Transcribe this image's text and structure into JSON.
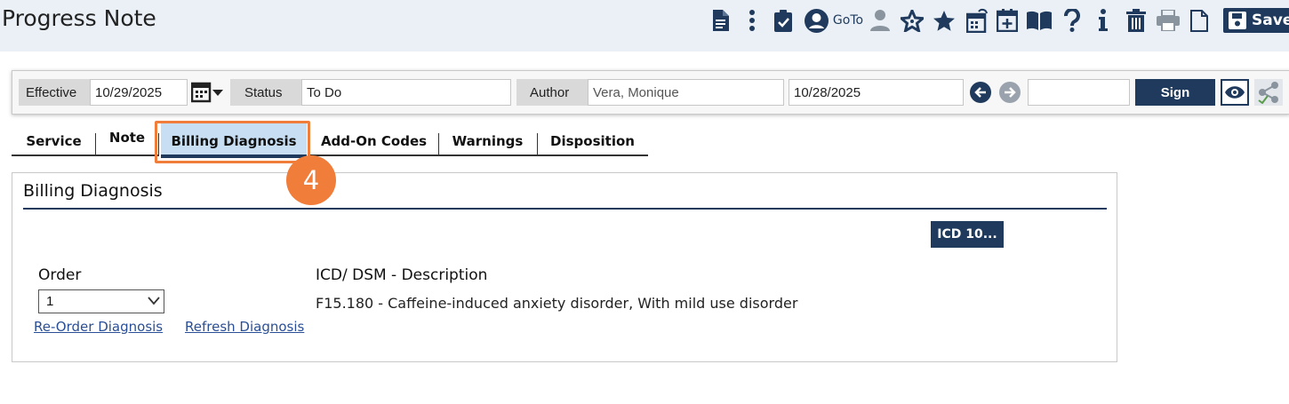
{
  "app": {
    "title": "Progress Note"
  },
  "toolbar": {
    "goto_label": "GoTo",
    "save_label": "Save",
    "icons": [
      "document-icon",
      "more-vertical-icon",
      "clipboard-check-icon",
      "user-circle-icon",
      "person-icon",
      "star-outline-icon",
      "star-icon",
      "calendar-refresh-icon",
      "calendar-plus-icon",
      "book-icon",
      "help-icon",
      "info-icon",
      "trash-icon",
      "print-icon",
      "new-file-icon",
      "save-icon"
    ]
  },
  "header": {
    "effective_label": "Effective",
    "effective_date": "10/29/2025",
    "status_label": "Status",
    "status_value": "To Do",
    "author_label": "Author",
    "author_value": "Vera, Monique",
    "date2": "10/28/2025",
    "extra_field": "",
    "sign_label": "Sign"
  },
  "tabs": [
    {
      "label": "Service"
    },
    {
      "label": "Note"
    },
    {
      "label": "Billing Diagnosis",
      "active": true
    },
    {
      "label": "Add-On Codes"
    },
    {
      "label": "Warnings"
    },
    {
      "label": "Disposition"
    }
  ],
  "callout": {
    "step": "4"
  },
  "billing": {
    "title": "Billing Diagnosis",
    "icd_button": "ICD 10...",
    "order_header": "Order",
    "desc_header": "ICD/ DSM - Description",
    "order_value": "1",
    "diagnosis": "F15.180 - Caffeine-induced anxiety disorder, With mild use disorder",
    "reorder_link": "Re-Order Diagnosis ",
    "refresh_link": "Refresh Diagnosis"
  },
  "colors": {
    "accent": "#1f3a5c",
    "highlight": "#f07d3a",
    "active_tab_bg": "#c8dff3"
  }
}
